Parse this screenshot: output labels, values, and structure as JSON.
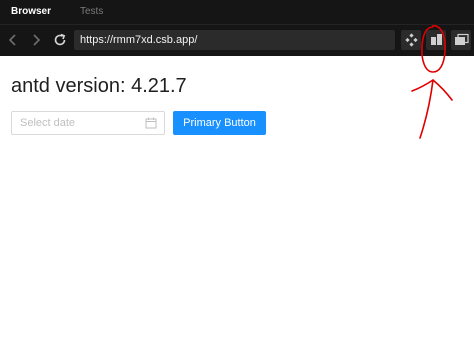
{
  "tabs": [
    {
      "label": "Browser",
      "active": true
    },
    {
      "label": "Tests",
      "active": false
    }
  ],
  "toolbar": {
    "back_icon": "chevron-left-icon",
    "forward_icon": "chevron-right-icon",
    "refresh_icon": "refresh-icon",
    "url": "https://rmm7xd.csb.app/",
    "devtools_icon": "devtools-icon",
    "split_icon": "split-view-icon",
    "window_icon": "open-window-icon"
  },
  "annotation": {
    "color": "#e00000",
    "shapes": [
      "circle",
      "arrow"
    ]
  },
  "page": {
    "title": "antd version: 4.21.7",
    "date_placeholder": "Select date",
    "primary_button": "Primary Button",
    "accent": "#1890ff"
  }
}
